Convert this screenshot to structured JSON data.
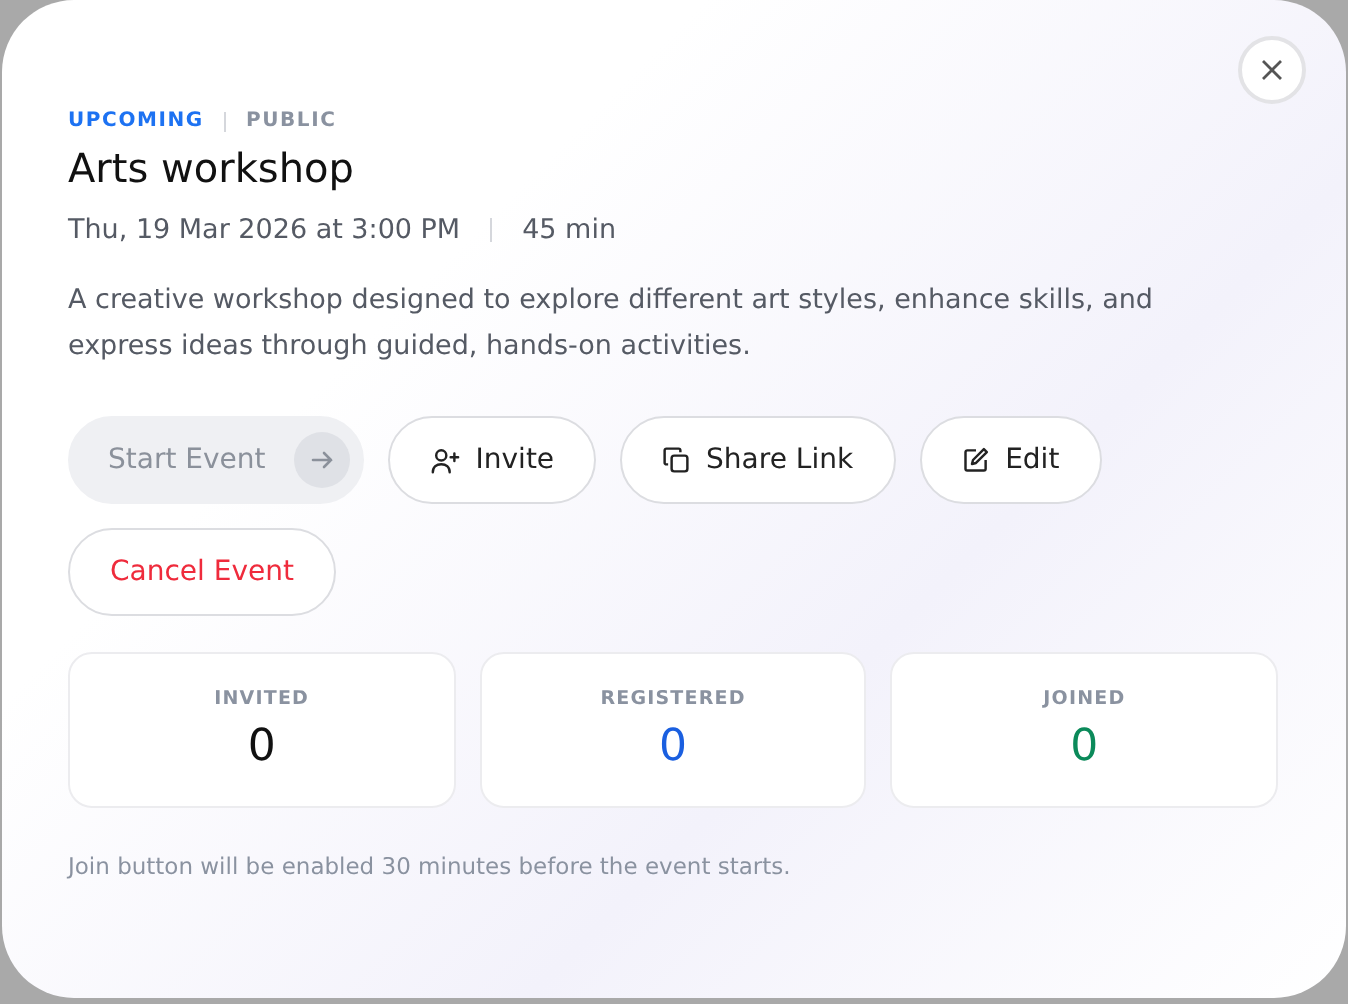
{
  "status": "UPCOMING",
  "visibility": "PUBLIC",
  "title": "Arts workshop",
  "date": "Thu, 19 Mar 2026 at 3:00 PM",
  "duration": "45 min",
  "description": "A creative workshop designed to explore different art styles, enhance skills, and express ideas through guided, hands-on activities.",
  "actions": [
    {
      "kind": "start",
      "label": "Start Event",
      "disabled": true
    },
    {
      "kind": "invite",
      "label": "Invite",
      "disabled": false
    },
    {
      "kind": "share",
      "label": "Share Link",
      "disabled": false
    },
    {
      "kind": "edit",
      "label": "Edit",
      "disabled": false
    },
    {
      "kind": "cancel",
      "label": "Cancel Event",
      "disabled": false
    }
  ],
  "stats": [
    {
      "label": "INVITED",
      "value": "0",
      "color": "#111111"
    },
    {
      "label": "REGISTERED",
      "value": "0",
      "color": "#1a5fe0"
    },
    {
      "label": "JOINED",
      "value": "0",
      "color": "#0b8a5a"
    }
  ],
  "note": "Join button will be enabled 30 minutes before the event starts."
}
